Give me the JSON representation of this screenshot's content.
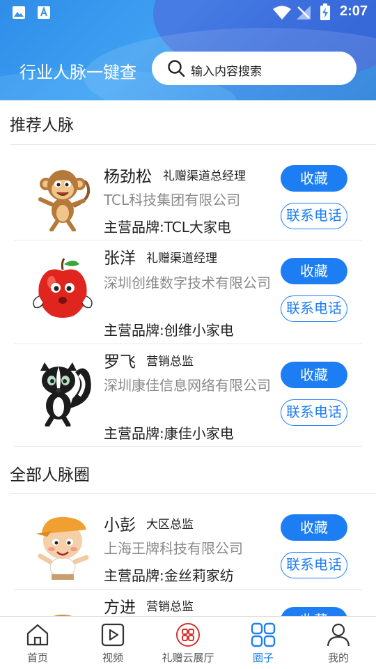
{
  "status_bar": {
    "time": "2:07"
  },
  "header": {
    "title": "行业人脉一键查",
    "search_placeholder": "输入内容搜索"
  },
  "recommended": {
    "title": "推荐人脉",
    "people": [
      {
        "name": "杨劲松",
        "role": "礼赠渠道总经理",
        "company": "TCL科技集团有限公司",
        "brand": "主营品牌:TCL大家电",
        "avatar_icon": "monkey-avatar",
        "fav_label": "收藏",
        "call_label": "联系电话"
      },
      {
        "name": "张洋",
        "role": "礼赠渠道经理",
        "company": "深圳创维数字技术有限公司",
        "brand": "主营品牌:创维小家电",
        "avatar_icon": "apple-avatar",
        "fav_label": "收藏",
        "call_label": "联系电话"
      },
      {
        "name": "罗飞",
        "role": "营销总监",
        "company": "深圳康佳信息网络有限公司",
        "brand": "主营品牌:康佳小家电",
        "avatar_icon": "skunk-avatar",
        "fav_label": "收藏",
        "call_label": "联系电话"
      }
    ]
  },
  "all_circle": {
    "title": "全部人脉圈",
    "people": [
      {
        "name": "小彭",
        "role": "大区总监",
        "company": "上海王牌科技有限公司",
        "brand": "主营品牌:金丝莉家纺",
        "avatar_icon": "boy-avatar",
        "fav_label": "收藏",
        "call_label": "联系电话"
      },
      {
        "name": "方进",
        "role": "营销总监",
        "avatar_icon": "partial-avatar",
        "fav_label": "收藏"
      }
    ]
  },
  "bottom_nav": [
    {
      "label": "首页",
      "icon": "home-icon"
    },
    {
      "label": "视频",
      "icon": "video-icon"
    },
    {
      "label": "礼赠云展厅",
      "icon": "gallery-icon"
    },
    {
      "label": "圈子",
      "icon": "circle-grid-icon",
      "active": true
    },
    {
      "label": "我的",
      "icon": "user-icon"
    }
  ],
  "colors": {
    "accent": "#1d7ef3",
    "header_gradient_start": "#2f8de8",
    "header_gradient_end": "#1f7ad8",
    "gallery_red": "#d9302c"
  }
}
